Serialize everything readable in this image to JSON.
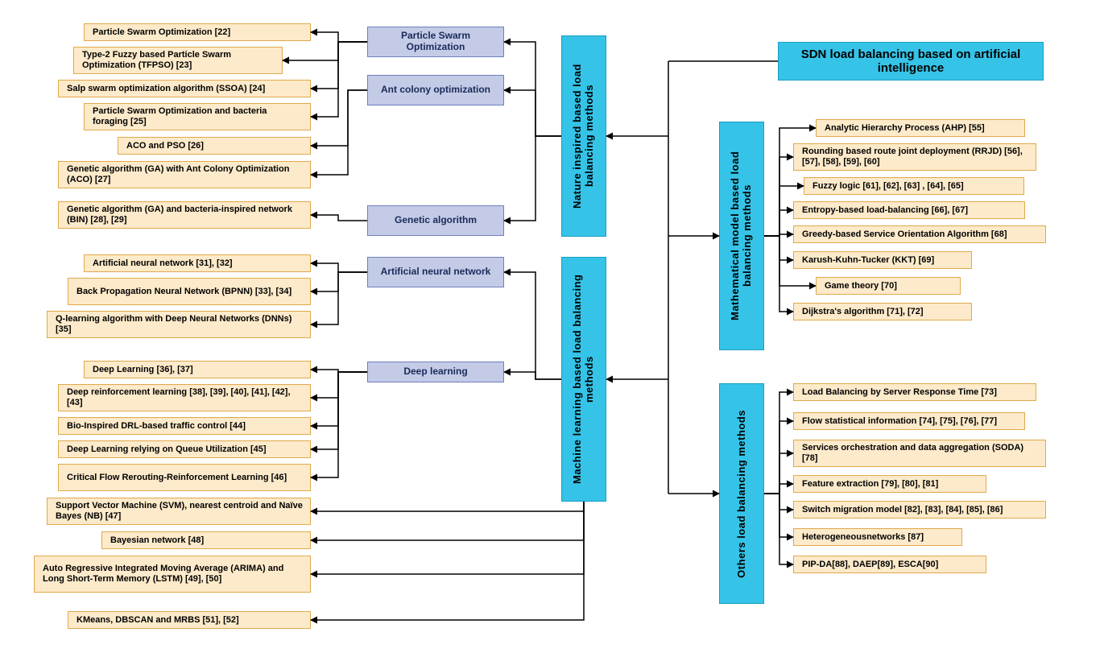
{
  "title": "SDN load balancing based  on artificial intelligence",
  "categories": {
    "nature": "Nature inspired based load balancing methods",
    "ml": "Machine learning based load balancing methods",
    "math": "Mathematical model based load balancing methods",
    "others": "Others load balancing methods"
  },
  "subcategories": {
    "pso": "Particle Swarm Optimization",
    "aco": "Ant colony optimization",
    "ga": "Genetic algorithm",
    "ann": "Artificial neural network",
    "dl": "Deep learning"
  },
  "leaves": {
    "pso1": "Particle Swarm Optimization [22]",
    "pso2": "Type-2 Fuzzy based Particle Swarm Optimization (TFPSO) [23]",
    "pso3": "Salp swarm optimization algorithm (SSOA) [24]",
    "pso4": "Particle Swarm Optimization and bacteria foraging [25]",
    "aco1": "ACO and PSO [26]",
    "aco2": "Genetic algorithm (GA) with Ant Colony Optimization (ACO) [27]",
    "ga1": "Genetic algorithm (GA) and bacteria-inspired network (BIN) [28], [29]",
    "ann1": "Artificial neural network [31], [32]",
    "ann2": "Back Propagation Neural Network (BPNN) [33], [34]",
    "ann3": "Q-learning algorithm with Deep Neural Networks (DNNs) [35]",
    "dl1": "Deep Learning [36], [37]",
    "dl2": "Deep reinforcement learning [38], [39], [40], [41], [42], [43]",
    "dl3": "Bio-Inspired DRL-based traffic control [44]",
    "dl4": "Deep Learning relying on Queue Utilization [45]",
    "dl5": "Critical Flow Rerouting-Reinforcement Learning [46]",
    "ml1": "Support Vector Machine (SVM), nearest centroid and Naïve Bayes (NB) [47]",
    "ml2": "Bayesian network [48]",
    "ml3": "Auto Regressive Integrated Moving Average (ARIMA) and Long Short-Term Memory (LSTM) [49], [50]",
    "ml4": "KMeans, DBSCAN and MRBS [51], [52]",
    "math1": "Analytic Hierarchy Process (AHP) [55]",
    "math2": "Rounding based route joint deployment (RRJD) [56], [57], [58], [59], [60]",
    "math3": "Fuzzy logic [61], [62], [63] , [64], [65]",
    "math4": "Entropy-based load-balancing [66], [67]",
    "math5": "Greedy-based Service Orientation Algorithm [68]",
    "math6": "Karush-Kuhn-Tucker (KKT) [69]",
    "math7": "Game theory [70]",
    "math8": "Dijkstra's algorithm [71], [72]",
    "oth1": "Load Balancing by Server Response Time [73]",
    "oth2": "Flow statistical information [74], [75], [76], [77]",
    "oth3": "Services orchestration and data aggregation (SODA) [78]",
    "oth4": "Feature extraction [79], [80], [81]",
    "oth5": "Switch migration model [82], [83], [84], [85], [86]",
    "oth6": "Heterogeneousnetworks [87]",
    "oth7": "PIP-DA[88], DAEP[89], ESCA[90]"
  }
}
